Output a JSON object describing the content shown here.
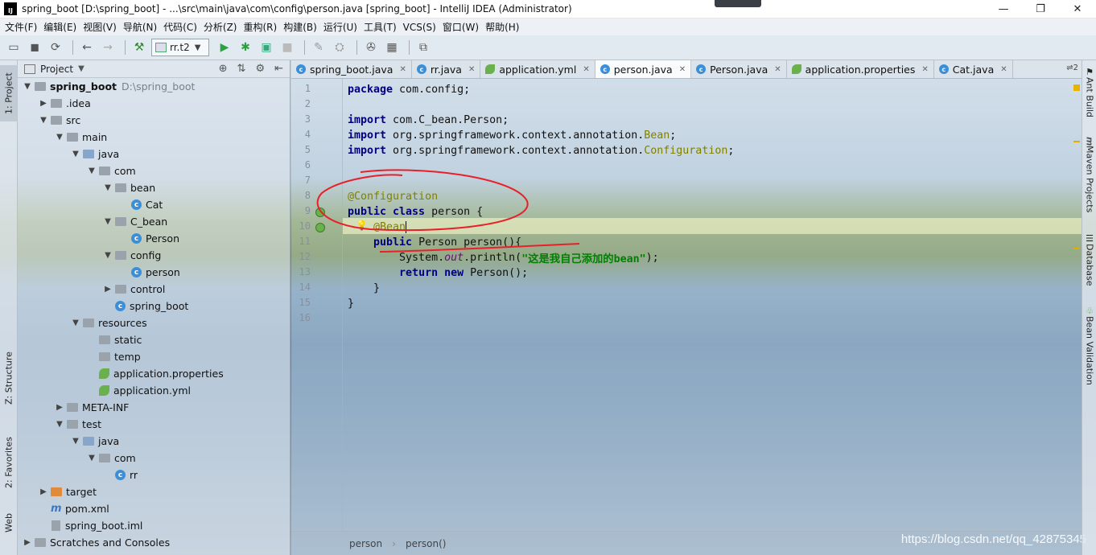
{
  "window": {
    "title": "spring_boot [D:\\spring_boot] - ...\\src\\main\\java\\com\\config\\person.java [spring_boot] - IntelliJ IDEA (Administrator)",
    "app_icon_text": "IJ",
    "minimize": "—",
    "maximize": "❐",
    "close": "✕"
  },
  "menu": [
    "文件(F)",
    "编辑(E)",
    "视图(V)",
    "导航(N)",
    "代码(C)",
    "分析(Z)",
    "重构(R)",
    "构建(B)",
    "运行(U)",
    "工具(T)",
    "VCS(S)",
    "窗口(W)",
    "帮助(H)"
  ],
  "toolbar": {
    "run_config": "rr.t2",
    "icons": [
      "folder-open-icon",
      "save-icon",
      "sync-icon",
      "back-arrow-icon",
      "forward-arrow-icon",
      "hammer-icon",
      "run-icon",
      "debug-icon",
      "coverage-icon",
      "stop-icon",
      "project-structure-icon",
      "terminal-icon",
      "search-icon",
      "structure-icon"
    ]
  },
  "left_strip": {
    "project_tab": "1: Project",
    "structure_tab": "Z: Structure",
    "favorites_tab": "2: Favorites",
    "web_tab": "Web"
  },
  "project_panel": {
    "title": "Project",
    "tree": [
      {
        "label": "spring_boot",
        "extra": "D:\\spring_boot",
        "depth": 0,
        "icon": "folder",
        "arrow": "▼",
        "bold": true
      },
      {
        "label": ".idea",
        "depth": 1,
        "icon": "folder",
        "arrow": "▶"
      },
      {
        "label": "src",
        "depth": 1,
        "icon": "folder",
        "arrow": "▼"
      },
      {
        "label": "main",
        "depth": 2,
        "icon": "folder",
        "arrow": "▼"
      },
      {
        "label": "java",
        "depth": 3,
        "icon": "folder-blue",
        "arrow": "▼"
      },
      {
        "label": "com",
        "depth": 4,
        "icon": "folder",
        "arrow": "▼"
      },
      {
        "label": "bean",
        "depth": 5,
        "icon": "folder",
        "arrow": "▼"
      },
      {
        "label": "Cat",
        "depth": 6,
        "icon": "class",
        "arrow": ""
      },
      {
        "label": "C_bean",
        "depth": 5,
        "icon": "folder",
        "arrow": "▼"
      },
      {
        "label": "Person",
        "depth": 6,
        "icon": "class",
        "arrow": ""
      },
      {
        "label": "config",
        "depth": 5,
        "icon": "folder",
        "arrow": "▼"
      },
      {
        "label": "person",
        "depth": 6,
        "icon": "class",
        "arrow": ""
      },
      {
        "label": "control",
        "depth": 5,
        "icon": "folder",
        "arrow": "▶"
      },
      {
        "label": "spring_boot",
        "depth": 5,
        "icon": "class-leaf",
        "arrow": ""
      },
      {
        "label": "resources",
        "depth": 3,
        "icon": "folder",
        "arrow": "▼"
      },
      {
        "label": "static",
        "depth": 4,
        "icon": "folder",
        "arrow": ""
      },
      {
        "label": "temp",
        "depth": 4,
        "icon": "folder",
        "arrow": ""
      },
      {
        "label": "application.properties",
        "depth": 4,
        "icon": "leaf",
        "arrow": ""
      },
      {
        "label": "application.yml",
        "depth": 4,
        "icon": "leaf",
        "arrow": ""
      },
      {
        "label": "META-INF",
        "depth": 2,
        "icon": "folder",
        "arrow": "▶"
      },
      {
        "label": "test",
        "depth": 2,
        "icon": "folder",
        "arrow": "▼"
      },
      {
        "label": "java",
        "depth": 3,
        "icon": "folder-blue",
        "arrow": "▼"
      },
      {
        "label": "com",
        "depth": 4,
        "icon": "folder",
        "arrow": "▼"
      },
      {
        "label": "rr",
        "depth": 5,
        "icon": "class-leaf",
        "arrow": ""
      },
      {
        "label": "target",
        "depth": 1,
        "icon": "folder-orange",
        "arrow": "▶"
      },
      {
        "label": "pom.xml",
        "depth": 1,
        "icon": "maven",
        "arrow": ""
      },
      {
        "label": "spring_boot.iml",
        "depth": 1,
        "icon": "file",
        "arrow": ""
      },
      {
        "label": "Scratches and Consoles",
        "depth": 0,
        "icon": "scratches",
        "arrow": "▶"
      }
    ]
  },
  "tabs": [
    {
      "label": "spring_boot.java",
      "icon": "class-leaf",
      "active": false
    },
    {
      "label": "rr.java",
      "icon": "class-leaf",
      "active": false
    },
    {
      "label": "application.yml",
      "icon": "leaf",
      "active": false
    },
    {
      "label": "person.java",
      "icon": "class",
      "active": true
    },
    {
      "label": "Person.java",
      "icon": "class",
      "active": false
    },
    {
      "label": "application.properties",
      "icon": "leaf",
      "active": false
    },
    {
      "label": "Cat.java",
      "icon": "class",
      "active": false
    }
  ],
  "tab_overflow": "⇌2",
  "editor": {
    "line_numbers": [
      "1",
      "2",
      "3",
      "4",
      "5",
      "6",
      "7",
      "8",
      "9",
      "10",
      "11",
      "12",
      "13",
      "14",
      "15",
      "16"
    ],
    "lines": [
      [
        {
          "t": "package",
          "c": "kw"
        },
        {
          "t": " com.config;"
        }
      ],
      [],
      [
        {
          "t": "import",
          "c": "kw"
        },
        {
          "t": " com.C_bean.Person;"
        }
      ],
      [
        {
          "t": "import",
          "c": "kw"
        },
        {
          "t": " org.springframework.context.annotation."
        },
        {
          "t": "Bean",
          "c": "ann"
        },
        {
          "t": ";"
        }
      ],
      [
        {
          "t": "import",
          "c": "kw"
        },
        {
          "t": " org.springframework.context.annotation."
        },
        {
          "t": "Configuration",
          "c": "ann"
        },
        {
          "t": ";"
        }
      ],
      [],
      [],
      [
        {
          "t": "@Configuration",
          "c": "ann"
        }
      ],
      [
        {
          "t": "public class",
          "c": "kw"
        },
        {
          "t": " person {"
        }
      ],
      [
        {
          "t": "    "
        },
        {
          "t": "@Bean",
          "c": "ann"
        },
        {
          "t": "",
          "c": "cursor"
        }
      ],
      [
        {
          "t": "    "
        },
        {
          "t": "public",
          "c": "kw"
        },
        {
          "t": " Person person(){"
        }
      ],
      [
        {
          "t": "        System."
        },
        {
          "t": "out",
          "c": "ital"
        },
        {
          "t": ".println("
        },
        {
          "t": "\"这是我自己添加的bean\"",
          "c": "str"
        },
        {
          "t": ");"
        }
      ],
      [
        {
          "t": "        "
        },
        {
          "t": "return new",
          "c": "kw"
        },
        {
          "t": " Person();"
        }
      ],
      [
        {
          "t": "    }"
        }
      ],
      [
        {
          "t": "}"
        }
      ],
      []
    ]
  },
  "breadcrumb": [
    "person",
    "person()"
  ],
  "right_strip": {
    "ant_build": "Ant Build",
    "maven_projects": "Maven Projects",
    "database": "Database",
    "bean_validation": "Bean Validation"
  },
  "watermark": "https://blog.csdn.net/qq_42875345",
  "colors": {
    "keyword": "#000080",
    "annotation": "#808000",
    "string": "#008000",
    "red_annotation": "#e8202a"
  }
}
